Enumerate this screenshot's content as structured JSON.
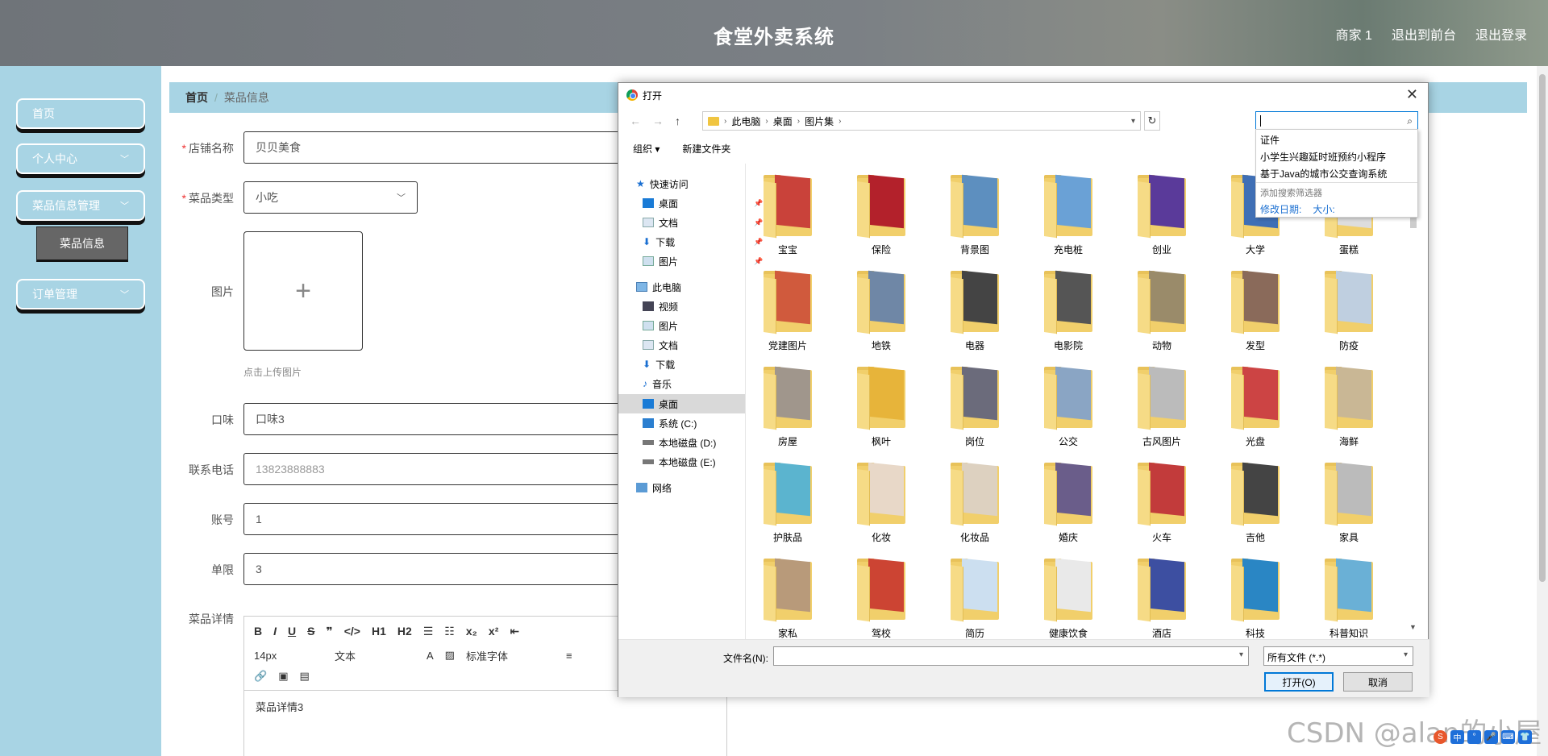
{
  "header": {
    "title": "食堂外卖系统",
    "nav": [
      "商家 1",
      "退出到前台",
      "退出登录"
    ]
  },
  "sidebar": {
    "items": [
      {
        "label": "首页",
        "chevron": false
      },
      {
        "label": "个人中心",
        "chevron": true
      },
      {
        "label": "菜品信息管理",
        "chevron": true
      },
      {
        "label": "订单管理",
        "chevron": true
      }
    ],
    "submenu_active": "菜品信息"
  },
  "breadcrumb": {
    "home": "首页",
    "separator": "/",
    "current": "菜品信息"
  },
  "form": {
    "shop_name": {
      "label": "店铺名称",
      "value": "贝贝美食"
    },
    "dish_type": {
      "label": "菜品类型",
      "value": "小吃"
    },
    "image": {
      "label": "图片",
      "hint": "点击上传图片"
    },
    "taste": {
      "label": "口味",
      "value": "口味3"
    },
    "phone": {
      "label": "联系电话",
      "value": "13823888883"
    },
    "account": {
      "label": "账号",
      "value": "1"
    },
    "limit": {
      "label": "单限",
      "value": "3"
    },
    "detail": {
      "label": "菜品详情",
      "toolbar_row1": [
        "B",
        "I",
        "U",
        "S",
        "❞",
        "</>",
        "H1",
        "H2",
        "☰",
        "☷",
        "x₂",
        "x²",
        "⇤"
      ],
      "font_size": "14px",
      "block_type": "文本",
      "font_family": "标准字体",
      "content": "菜品详情3"
    }
  },
  "dialog": {
    "title": "打开",
    "path": [
      "此电脑",
      "桌面",
      "图片集"
    ],
    "commands": [
      "组织 ▾",
      "新建文件夹"
    ],
    "search_suggestions": [
      "证件",
      "小学生兴趣延时班预约小程序",
      "基于Java的城市公交查询系统"
    ],
    "search_filter_title": "添加搜索筛选器",
    "search_filters": [
      "修改日期:",
      "大小:"
    ],
    "nav_pane": {
      "quick_access": "快速访问",
      "quick_items": [
        "桌面",
        "文档",
        "下载",
        "图片"
      ],
      "this_pc": "此电脑",
      "pc_items": [
        "视频",
        "图片",
        "文档",
        "下载",
        "音乐",
        "桌面",
        "系统 (C:)",
        "本地磁盘 (D:)",
        "本地磁盘 (E:)"
      ],
      "network": "网络",
      "selected": "桌面"
    },
    "folders": [
      "宝宝",
      "保险",
      "背景图",
      "充电桩",
      "创业",
      "大学",
      "蛋糕",
      "党建图片",
      "地铁",
      "电器",
      "电影院",
      "动物",
      "发型",
      "防疫",
      "房屋",
      "枫叶",
      "岗位",
      "公交",
      "古风图片",
      "光盘",
      "海鲜",
      "护肤品",
      "化妆",
      "化妆品",
      "婚庆",
      "火车",
      "吉他",
      "家具",
      "家私",
      "驾校",
      "简历",
      "健康饮食",
      "酒店",
      "科技",
      "科普知识"
    ],
    "folder_colors": [
      "#c9423a",
      "#b3212b",
      "#5d8fbf",
      "#6aa1d6",
      "#5a3a9a",
      "#3f6fb5",
      "#ddd",
      "#d05a3d",
      "#6f87a6",
      "#444",
      "#555",
      "#9a8b6a",
      "#8a6a5a",
      "#bfcfe0",
      "#a0968c",
      "#e7b43a",
      "#6b6b7b",
      "#8aa5c4",
      "#bbb",
      "#c44",
      "#c9b795",
      "#5bb4cf",
      "#e8d8c8",
      "#ddd1c0",
      "#6a5d8a",
      "#c23b3b",
      "#444",
      "#bbb",
      "#b89a7a",
      "#cc4433",
      "#ccdff0",
      "#e9e9e9",
      "#3d4fa1",
      "#2a86c4",
      "#6ab0d6"
    ],
    "file_name_label": "文件名(N):",
    "file_name_value": "",
    "file_type": "所有文件 (*.*)",
    "open_button": "打开(O)",
    "cancel_button": "取消"
  },
  "watermark": "CSDN @alan的小屋"
}
